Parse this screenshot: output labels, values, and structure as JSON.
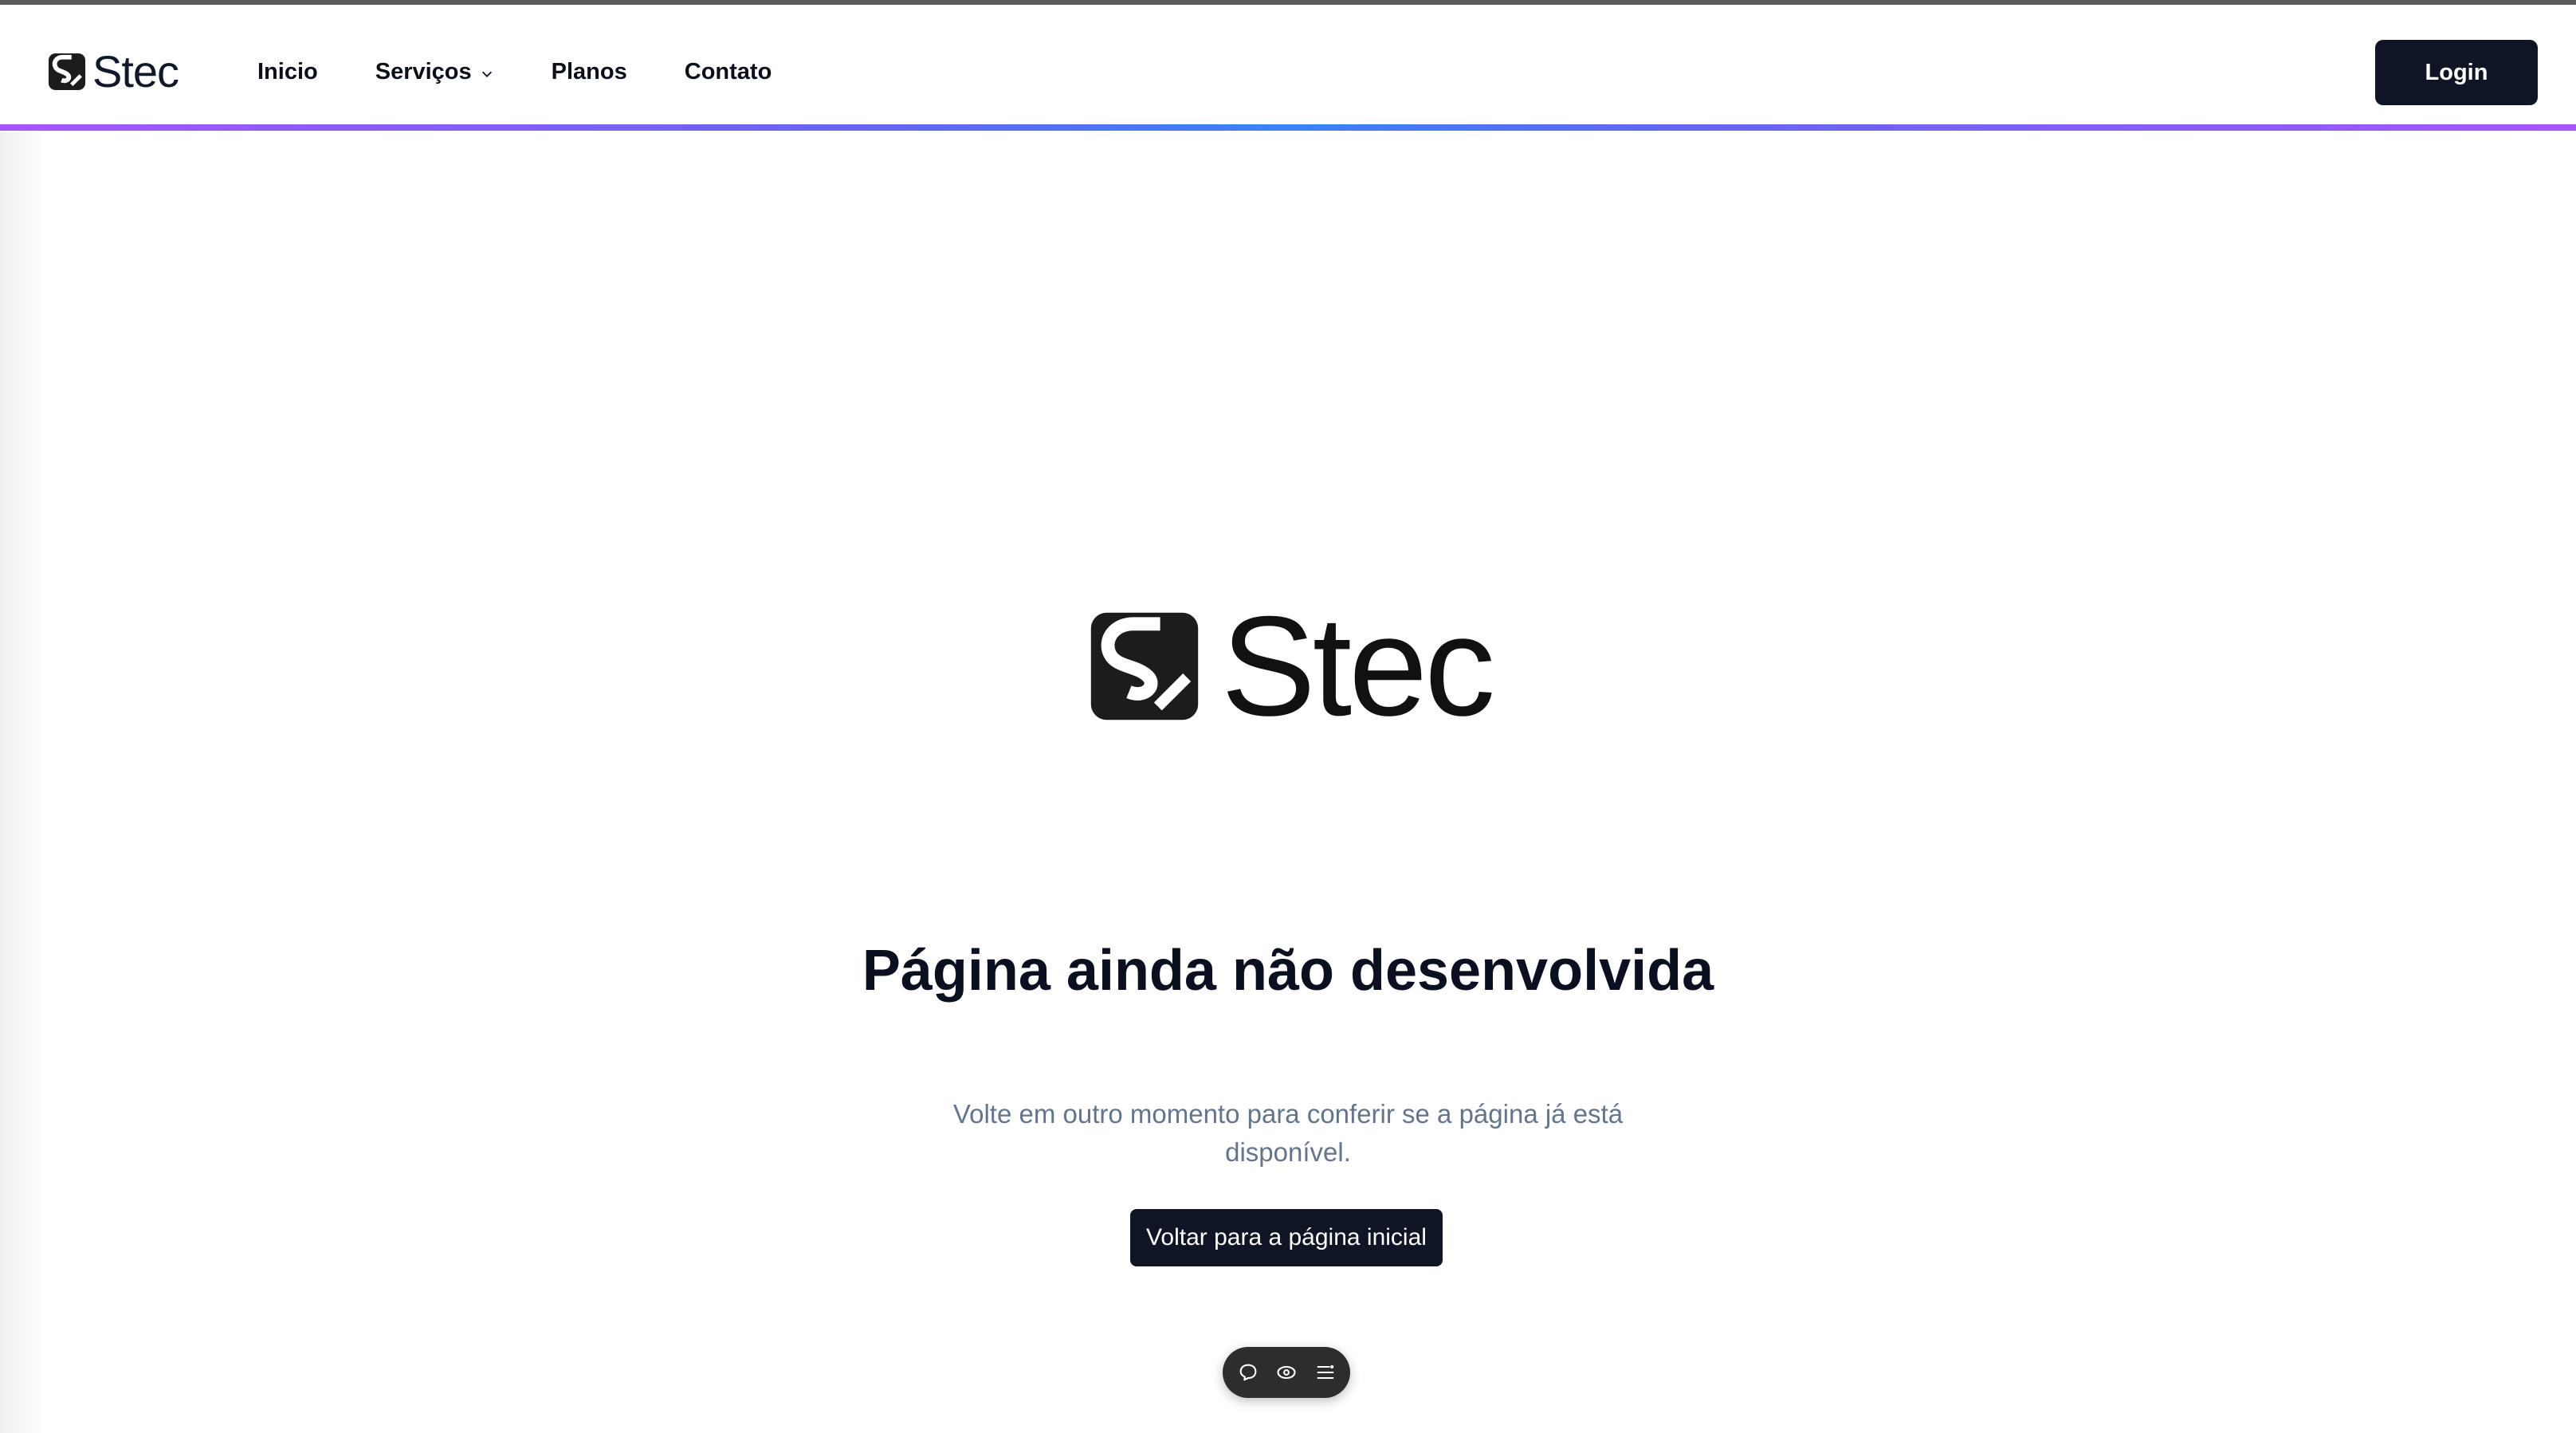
{
  "header": {
    "brand_name": "Stec",
    "nav": [
      {
        "label": "Inicio"
      },
      {
        "label": "Serviços",
        "has_dropdown": true
      },
      {
        "label": "Planos"
      },
      {
        "label": "Contato"
      }
    ],
    "login_label": "Login"
  },
  "main": {
    "brand_name": "Stec",
    "title": "Página ainda não desenvolvida",
    "subtitle": "Volte em outro momento para conferir se a página já está disponível.",
    "cta_label": "Voltar para a página inicial"
  },
  "toolbar": {
    "icons": [
      "comment-icon",
      "eye-icon",
      "menu-icon"
    ]
  },
  "colors": {
    "primary_dark": "#0f1524",
    "accent_gradient": [
      "#a855f7",
      "#3b82f6"
    ],
    "subtitle_gray": "#64748b"
  }
}
